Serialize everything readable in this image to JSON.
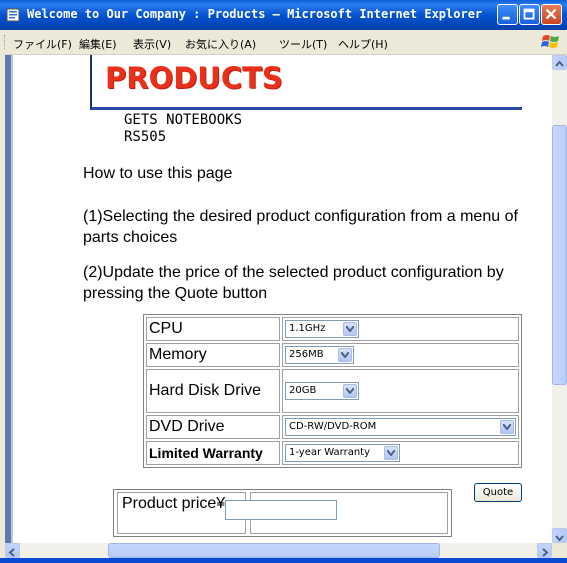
{
  "window": {
    "title": "Welcome to Our Company : Products – Microsoft Internet Explorer"
  },
  "menu": {
    "items": [
      "ファイル(F)",
      "編集(E)",
      "表示(V)",
      "お気に入り(A)",
      "ツール(T)",
      "ヘルプ(H)"
    ]
  },
  "page": {
    "title": "PRODUCTS",
    "product_line1": "GETS NOTEBOOKS",
    "product_line2": "RS505",
    "how_to": "How to use this page",
    "step1": "(1)Selecting the desired product configuration from a menu of parts choices",
    "step2": "(2)Update the price of the selected product configuration by pressing the Quote button"
  },
  "config": {
    "rows": [
      {
        "label": "CPU",
        "value": "1.1GHz"
      },
      {
        "label": "Memory",
        "value": "256MB"
      },
      {
        "label": "Hard Disk Drive",
        "value": "20GB"
      },
      {
        "label": "DVD Drive",
        "value": "CD-RW/DVD-ROM"
      },
      {
        "label": "Limited Warranty",
        "value": "1-year Warranty"
      }
    ]
  },
  "price": {
    "label": "Product price¥",
    "quote_button": "Quote",
    "value": ""
  }
}
